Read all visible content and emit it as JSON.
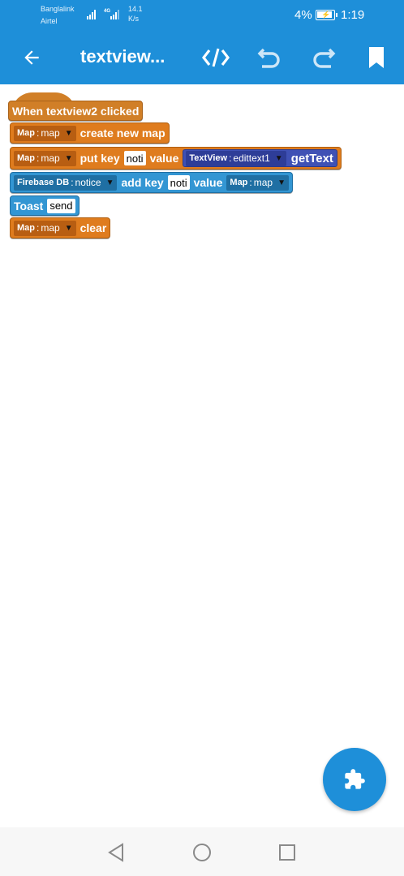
{
  "status_bar": {
    "carrier_1": "Banglalink",
    "carrier_2": "Airtel",
    "network_type": "4G",
    "speed_value": "14.1",
    "speed_unit": "K/s",
    "battery_percent": "4%",
    "time": "1:19"
  },
  "app_bar": {
    "title": "textview...",
    "back_icon": "arrow-left-icon",
    "code_icon": "code-icon",
    "undo_icon": "undo-icon",
    "redo_icon": "redo-icon",
    "bookmark_icon": "bookmark-icon",
    "color": "#1e8fd9"
  },
  "blocks": {
    "event": {
      "label": "When textview2 clicked",
      "color": "#d17f27"
    },
    "create_map": {
      "type": "Map",
      "var": "map",
      "label": "create new map",
      "color": "#df7c1e"
    },
    "put_key": {
      "type": "Map",
      "var": "map",
      "label_put": "put key",
      "key": "noti",
      "label_value": "value",
      "tv_type": "TextView",
      "tv_var": "edittext1",
      "tv_method": "getText"
    },
    "add_key": {
      "type": "Firebase DB",
      "var": "notice",
      "label_add": "add key",
      "key": "noti",
      "label_value": "value",
      "map_type": "Map",
      "map_var": "map",
      "color": "#3396d3"
    },
    "toast": {
      "label": "Toast",
      "text": "send"
    },
    "clear_map": {
      "type": "Map",
      "var": "map",
      "label": "clear"
    }
  },
  "fab": {
    "icon": "puzzle-piece-icon"
  },
  "nav_bar": {
    "back": "nav-back-icon",
    "home": "nav-home-icon",
    "recents": "nav-recents-icon"
  }
}
